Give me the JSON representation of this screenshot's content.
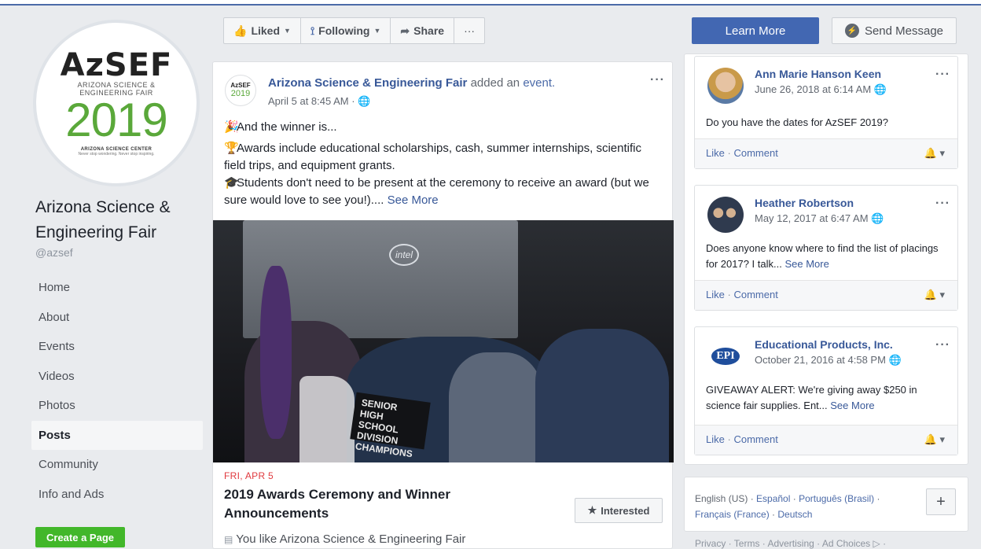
{
  "page": {
    "name": "Arizona Science & Engineering Fair",
    "handle": "@azsef",
    "logo": {
      "abbr": "AzSEF",
      "line1": "ARIZONA SCIENCE &",
      "line2": "ENGINEERING FAIR",
      "year": "2019",
      "center": "ARIZONA SCIENCE CENTER",
      "tagline": "Never stop wondering. Never stop inspiring."
    }
  },
  "nav": {
    "items": [
      "Home",
      "About",
      "Events",
      "Videos",
      "Photos",
      "Posts",
      "Community",
      "Info and Ads"
    ],
    "active": "Posts",
    "create_page": "Create a Page"
  },
  "actions": {
    "liked": "Liked",
    "following": "Following",
    "share": "Share",
    "more": "···",
    "learn_more": "Learn More",
    "send_message": "Send Message"
  },
  "post": {
    "author": "Arizona Science & Engineering Fair",
    "action": "added an",
    "action_link": "event.",
    "time": "April 5 at 8:45 AM ·",
    "line1": "And the winner is...",
    "line2": "Awards include educational scholarships, cash, summer internships, scientific field trips, and equipment grants.",
    "line3": "Students don't need to be present at the ceremony to receive an award (but we sure would love to see you!)....",
    "see_more": "See More",
    "photo": {
      "screen_logo": "intel",
      "banner": "SENIOR HIGH SCHOOL DIVISION CHAMPIONS"
    },
    "event_date": "FRI, APR 5",
    "event_title": "2019 Awards Ceremony and Winner Announcements",
    "interested": "Interested",
    "you_like": "You like Arizona Science & Engineering Fair"
  },
  "reviews": [
    {
      "name": "Ann Marie Hanson Keen",
      "date": "June 26, 2018 at 6:14 AM",
      "text": "Do you have the dates for AzSEF 2019?",
      "see_more": "",
      "like": "Like",
      "comment": "Comment"
    },
    {
      "name": "Heather Robertson",
      "date": "May 12, 2017 at 6:47 AM",
      "text": "Does anyone know where to find the list of placings for 2017? I talk...",
      "see_more": "See More",
      "like": "Like",
      "comment": "Comment"
    },
    {
      "name": "Educational Products, Inc.",
      "date": "October 21, 2016 at 4:58 PM",
      "text": "GIVEAWAY ALERT: We're giving away $250 in science fair supplies. Ent...",
      "see_more": "See More",
      "like": "Like",
      "comment": "Comment",
      "avatar_text": "EPI"
    }
  ],
  "footer": {
    "languages": [
      "English (US)",
      "Español",
      "Português (Brasil)",
      "Français (France)",
      "Deutsch"
    ],
    "plus": "+",
    "links": "Privacy · Terms · Advertising · Ad Choices ▷ ·"
  }
}
